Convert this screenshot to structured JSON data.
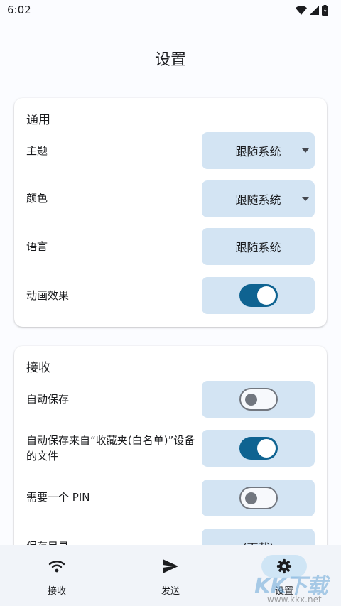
{
  "status_bar": {
    "time": "6:02"
  },
  "header": {
    "title": "设置"
  },
  "general": {
    "section_title": "通用",
    "theme": {
      "label": "主题",
      "value": "跟随系统"
    },
    "color": {
      "label": "颜色",
      "value": "跟随系统"
    },
    "language": {
      "label": "语言",
      "value": "跟随系统"
    },
    "animations": {
      "label": "动画效果",
      "enabled": true
    }
  },
  "receive": {
    "section_title": "接收",
    "auto_save": {
      "label": "自动保存",
      "enabled": false
    },
    "auto_save_favorites": {
      "label_line1": "自动保存来自“收藏夹(白名单)”设备",
      "label_line2": "的文件",
      "enabled": true
    },
    "require_pin": {
      "label": "需要一个 PIN",
      "enabled": false
    },
    "save_directory": {
      "label": "保存目录",
      "value": "(下载)"
    }
  },
  "bottom_nav": {
    "items": [
      {
        "label": "接收",
        "icon": "wifi-icon"
      },
      {
        "label": "发送",
        "icon": "send-icon"
      },
      {
        "label": "设置",
        "icon": "gear-icon",
        "active": true
      }
    ]
  },
  "watermark": {
    "text": "KK下载",
    "url_text": "www.kkx.net"
  },
  "colors": {
    "control_bg": "#d3e4f3",
    "switch_on": "#0f6391",
    "switch_off_outline": "#72777f",
    "nav_bg": "#f1f4f9",
    "nav_active": "#cfe5f5"
  }
}
